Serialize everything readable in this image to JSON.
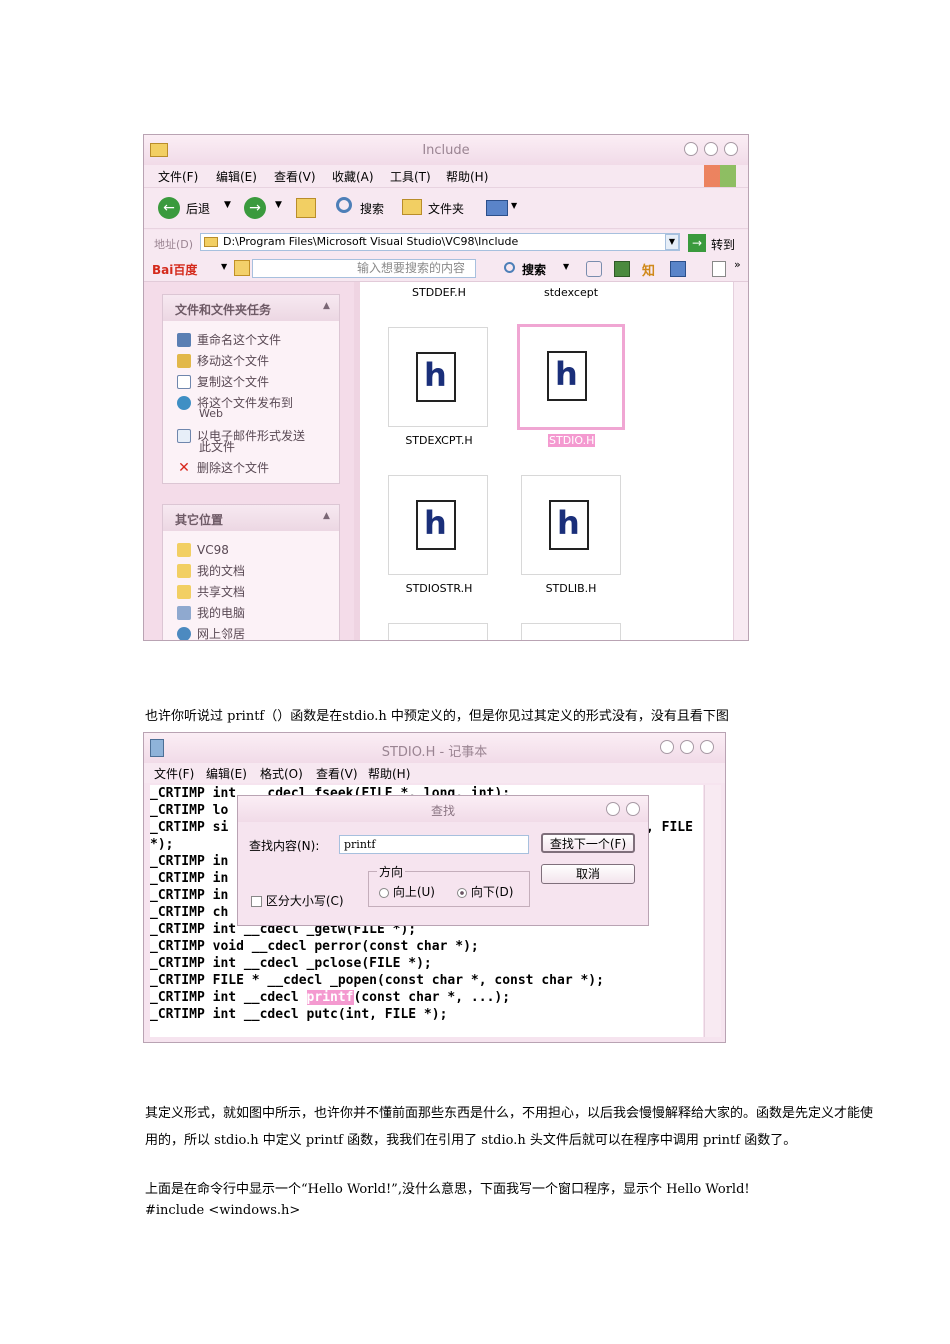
{
  "explorer": {
    "title": "Include",
    "menu": [
      "文件(F)",
      "编辑(E)",
      "查看(V)",
      "收藏(A)",
      "工具(T)",
      "帮助(H)"
    ],
    "toolbar": {
      "back": "后退",
      "search": "搜索",
      "folders": "文件夹"
    },
    "address_label": "地址(D)",
    "address_value": "D:\\Program Files\\Microsoft Visual Studio\\VC98\\Include",
    "go_label": "转到",
    "baidu": {
      "logo": "Bai百度",
      "placeholder": "输入想要搜索的内容",
      "search_label": "搜索",
      "zhi": "知"
    },
    "tasks_panel": {
      "title": "文件和文件夹任务",
      "items": [
        "重命名这个文件",
        "移动这个文件",
        "复制这个文件",
        "将这个文件发布到",
        "Web",
        "以电子邮件形式发送",
        "此文件",
        "删除这个文件"
      ]
    },
    "places_panel": {
      "title": "其它位置",
      "items": [
        "VC98",
        "我的文档",
        "共享文档",
        "我的电脑",
        "网上邻居"
      ]
    },
    "files": {
      "top_row": [
        "STDDEF.H",
        "stdexcept"
      ],
      "tile_letter": "h",
      "items": [
        "STDEXCPT.H",
        "STDIO.H",
        "STDIOSTR.H",
        "STDLIB.H"
      ]
    }
  },
  "para1": "也许你听说过 printf（）函数是在stdio.h 中预定义的，但是你见过其定义的形式没有，没有且看下图",
  "notepad": {
    "title": "STDIO.H - 记事本",
    "menu": [
      "文件(F)",
      "编辑(E)",
      "格式(O)",
      "查看(V)",
      "帮助(H)"
    ],
    "code": {
      "l1": "_CRTIMP int  __cdecl fseek(FILE *, long, int);",
      "l2": "_CRTIMP lo",
      "l3a": "_CRTIMP si",
      "l3b": ", FILE",
      "l4": "*);",
      "l5": "_CRTIMP in",
      "l6": "_CRTIMP in",
      "l7": "_CRTIMP in",
      "l8": "_CRTIMP ch",
      "l9": "_CRTIMP int __cdecl _getw(FILE *);",
      "l10": "_CRTIMP void __cdecl perror(const char *);",
      "l11": "_CRTIMP int __cdecl _pclose(FILE *);",
      "l12": "_CRTIMP FILE * __cdecl _popen(const char *, const char *);",
      "l13a": "_CRTIMP int __cdecl ",
      "l13hl": "printf",
      "l13b": "(const char *, ...);",
      "l14": "_CRTIMP int __cdecl putc(int, FILE *);"
    }
  },
  "find_dialog": {
    "title": "查找",
    "find_label": "查找内容(N):",
    "find_value": "printf",
    "find_next": "查找下一个(F)",
    "cancel": "取消",
    "direction": "方向",
    "up": "向上(U)",
    "down": "向下(D)",
    "match_case": "区分大小写(C)"
  },
  "para2a": "其定义形式，就如图中所示，也许你并不懂前面那些东西是什么，不用担心，以后我会慢慢解释给大家的。函数是先定义才能使",
  "para2b": "用的，所以 stdio.h 中定义 printf 函数，我我们在引用了 stdio.h 头文件后就可以在程序中调用 printf 函数了。",
  "para3": "上面是在命令行中显示一个“Hello World!”,没什么意思，下面我写一个窗口程序，显示个 Hello World!",
  "para4": "#include <windows.h>"
}
